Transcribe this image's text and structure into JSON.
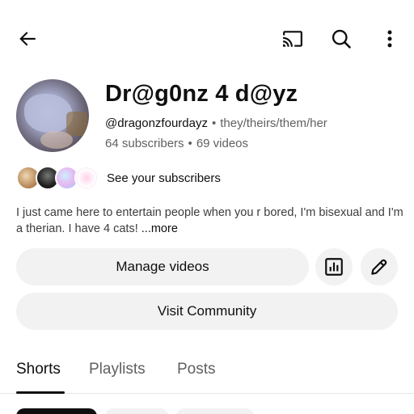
{
  "channel": {
    "name": "Dr@g0nz 4 d@yz",
    "handle": "@dragonzfourdayz",
    "pronouns": "they/theirs/them/her",
    "subscribers": "64 subscribers",
    "videos": "69 videos",
    "separator": "•"
  },
  "subscribers_row": {
    "label": "See your subscribers"
  },
  "description": {
    "text": "I just came here to entertain people when you r bored, I'm bisexual and I'm a therian. I have 4 cats!",
    "more": "...more"
  },
  "actions": {
    "manage_videos": "Manage videos",
    "visit_community": "Visit Community"
  },
  "tabs": [
    {
      "label": "Shorts",
      "active": true
    },
    {
      "label": "Playlists",
      "active": false
    },
    {
      "label": "Posts",
      "active": false
    }
  ],
  "icons": {
    "back": "arrow-left-icon",
    "cast": "cast-icon",
    "search": "search-icon",
    "more": "more-vertical-icon",
    "stats": "bar-chart-icon",
    "edit": "pencil-icon"
  }
}
